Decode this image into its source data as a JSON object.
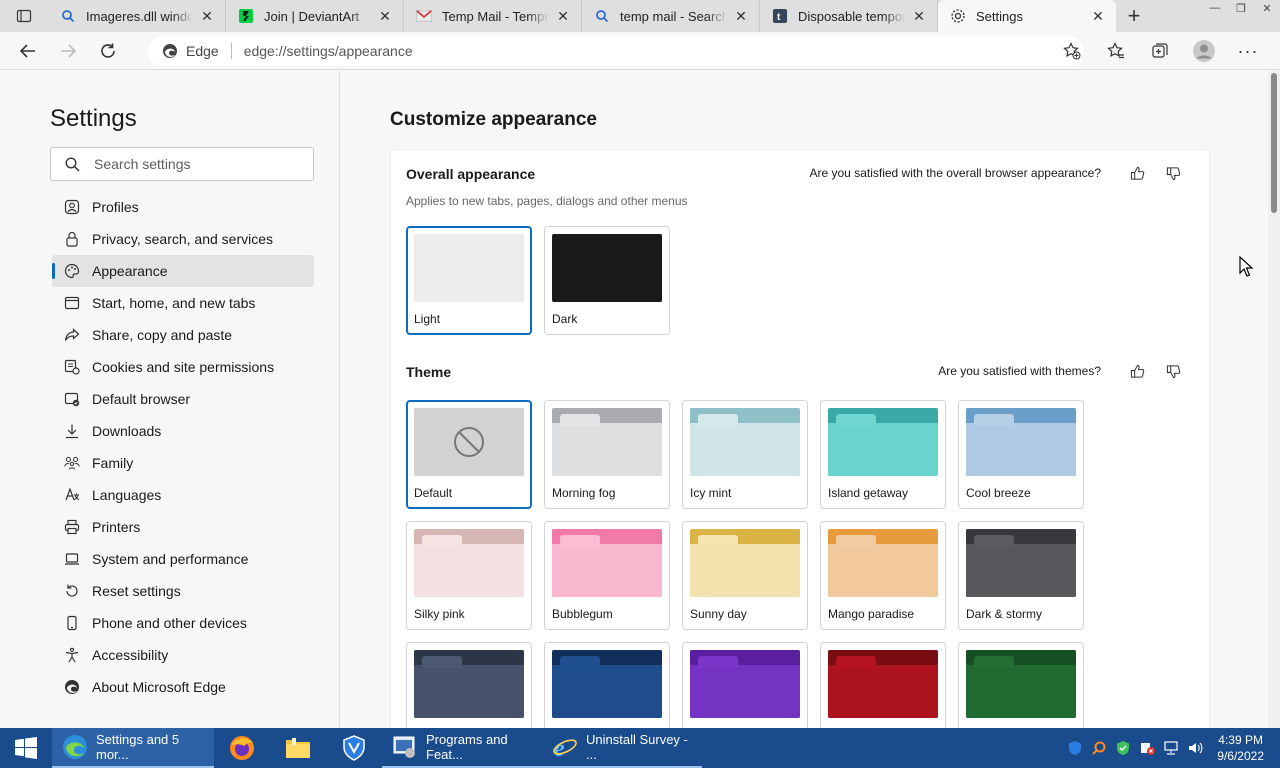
{
  "tabs": [
    {
      "title": "Imageres.dll window",
      "icon": "search-icon"
    },
    {
      "title": "Join | DeviantArt",
      "icon": "deviantart-icon"
    },
    {
      "title": "Temp Mail - Tempor",
      "icon": "mail-icon"
    },
    {
      "title": "temp mail - Search",
      "icon": "search-icon"
    },
    {
      "title": "Disposable tempora",
      "icon": "tumblr-icon"
    },
    {
      "title": "Settings",
      "icon": "gear-icon",
      "active": true
    }
  ],
  "address": {
    "brand": "Edge",
    "url": "edge://settings/appearance"
  },
  "sidebar": {
    "title": "Settings",
    "search_placeholder": "Search settings",
    "items": [
      {
        "label": "Profiles",
        "icon": "profile-icon"
      },
      {
        "label": "Privacy, search, and services",
        "icon": "lock-icon"
      },
      {
        "label": "Appearance",
        "icon": "palette-icon",
        "active": true
      },
      {
        "label": "Start, home, and new tabs",
        "icon": "window-icon"
      },
      {
        "label": "Share, copy and paste",
        "icon": "share-icon"
      },
      {
        "label": "Cookies and site permissions",
        "icon": "cookies-icon"
      },
      {
        "label": "Default browser",
        "icon": "browser-icon"
      },
      {
        "label": "Downloads",
        "icon": "download-icon"
      },
      {
        "label": "Family",
        "icon": "family-icon"
      },
      {
        "label": "Languages",
        "icon": "languages-icon"
      },
      {
        "label": "Printers",
        "icon": "printer-icon"
      },
      {
        "label": "System and performance",
        "icon": "laptop-icon"
      },
      {
        "label": "Reset settings",
        "icon": "reset-icon"
      },
      {
        "label": "Phone and other devices",
        "icon": "phone-icon"
      },
      {
        "label": "Accessibility",
        "icon": "accessibility-icon"
      },
      {
        "label": "About Microsoft Edge",
        "icon": "edge-logo-icon"
      }
    ]
  },
  "main": {
    "title": "Customize appearance",
    "overall": {
      "title": "Overall appearance",
      "subtitle": "Applies to new tabs, pages, dialogs and other menus",
      "feedback": "Are you satisfied with the overall browser appearance?",
      "options": [
        {
          "label": "Light",
          "selected": true,
          "color": "#ececec"
        },
        {
          "label": "Dark",
          "selected": false,
          "color": "#1a1a1a"
        }
      ]
    },
    "theme": {
      "title": "Theme",
      "feedback": "Are you satisfied with themes?",
      "options": [
        {
          "label": "Default",
          "selected": true,
          "band": "#d2d2d2",
          "tab": "#d2d2d2",
          "body": "#d2d2d2"
        },
        {
          "label": "Morning fog",
          "band": "#a9abae",
          "tab": "#e3e4e6",
          "body": "#dedfe1"
        },
        {
          "label": "Icy mint",
          "band": "#8fbfc7",
          "tab": "#d5e9ec",
          "body": "#cfe5e8"
        },
        {
          "label": "Island getaway",
          "band": "#3aa9a6",
          "tab": "#6fd6d0",
          "body": "#6ad5cf"
        },
        {
          "label": "Cool breeze",
          "band": "#6a9dc8",
          "tab": "#b7cfe6",
          "body": "#aecae4"
        },
        {
          "label": "Silky pink",
          "band": "#d6b6b3",
          "tab": "#f5e2e2",
          "body": "#f3e0e0"
        },
        {
          "label": "Bubblegum",
          "band": "#f27aa8",
          "tab": "#fbbcd4",
          "body": "#f9b7d0"
        },
        {
          "label": "Sunny day",
          "band": "#d9b344",
          "tab": "#f4e5b0",
          "body": "#f1e2ae"
        },
        {
          "label": "Mango paradise",
          "band": "#e89b3c",
          "tab": "#f3cda2",
          "body": "#f1c99c"
        },
        {
          "label": "Dark & stormy",
          "band": "#36383c",
          "tab": "#5a5c60",
          "body": "#56585c"
        },
        {
          "label": "",
          "band": "#2c3647",
          "tab": "#4c5870",
          "body": "#46526a"
        },
        {
          "label": "",
          "band": "#122f5c",
          "tab": "#1f4f8e",
          "body": "#1f4d8b"
        },
        {
          "label": "",
          "band": "#5a1f9e",
          "tab": "#7a36c8",
          "body": "#7433c2"
        },
        {
          "label": "",
          "band": "#7a0d14",
          "tab": "#b4141f",
          "body": "#ad131d"
        },
        {
          "label": "",
          "band": "#174f24",
          "tab": "#236f33",
          "body": "#216b31"
        }
      ]
    }
  },
  "taskbar": {
    "items": [
      {
        "label": "Settings and 5 mor...",
        "icon": "edge-icon",
        "active": true
      },
      {
        "label": "",
        "icon": "firefox-icon"
      },
      {
        "label": "",
        "icon": "folder-icon"
      },
      {
        "label": "",
        "icon": "shield-app-icon"
      },
      {
        "label": "Programs and Feat...",
        "icon": "programs-icon",
        "running": true
      },
      {
        "label": "Uninstall Survey - ...",
        "icon": "ie-icon",
        "running": true
      }
    ],
    "time": "4:39 PM",
    "date": "9/6/2022"
  },
  "colors": {
    "accent": "#0f6cbd",
    "taskbar": "#1a4b8c"
  }
}
